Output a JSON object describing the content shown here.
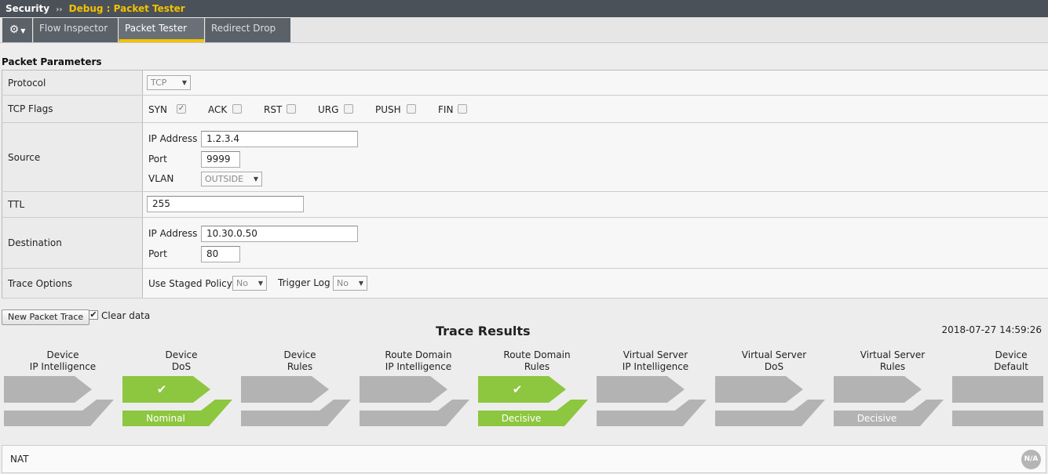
{
  "breadcrumb": {
    "root": "Security",
    "separator": "››",
    "current": "Debug : Packet Tester"
  },
  "tabs": [
    {
      "label": "Flow Inspector"
    },
    {
      "label": "Packet Tester"
    },
    {
      "label": "Redirect Drop"
    }
  ],
  "section_title": "Packet Parameters",
  "params": {
    "protocol": {
      "label": "Protocol",
      "value": "TCP"
    },
    "tcp_flags": {
      "label": "TCP Flags",
      "flags": [
        {
          "name": "SYN",
          "checked": true
        },
        {
          "name": "ACK",
          "checked": false
        },
        {
          "name": "RST",
          "checked": false
        },
        {
          "name": "URG",
          "checked": false
        },
        {
          "name": "PUSH",
          "checked": false
        },
        {
          "name": "FIN",
          "checked": false
        }
      ]
    },
    "source": {
      "label": "Source",
      "ip_label": "IP Address",
      "ip": "1.2.3.4",
      "port_label": "Port",
      "port": "9999",
      "vlan_label": "VLAN",
      "vlan": "OUTSIDE"
    },
    "ttl": {
      "label": "TTL",
      "value": "255"
    },
    "destination": {
      "label": "Destination",
      "ip_label": "IP Address",
      "ip": "10.30.0.50",
      "port_label": "Port",
      "port": "80"
    },
    "trace_options": {
      "label": "Trace Options",
      "staged_label": "Use Staged Policy",
      "staged_value": "No",
      "trigger_label": "Trigger Log",
      "trigger_value": "No"
    }
  },
  "controls": {
    "new_trace": "New Packet Trace",
    "clear_data": "Clear data",
    "clear_checked": true
  },
  "trace": {
    "title": "Trace Results",
    "timestamp": "2018-07-27 14:59:26",
    "stages": [
      {
        "line1": "Device",
        "line2": "IP Intelligence",
        "state": "none",
        "result": ""
      },
      {
        "line1": "Device",
        "line2": "DoS",
        "state": "pass",
        "result": "Nominal"
      },
      {
        "line1": "Device",
        "line2": "Rules",
        "state": "none",
        "result": ""
      },
      {
        "line1": "Route Domain",
        "line2": "IP Intelligence",
        "state": "none",
        "result": ""
      },
      {
        "line1": "Route Domain",
        "line2": "Rules",
        "state": "pass",
        "result": "Decisive"
      },
      {
        "line1": "Virtual Server",
        "line2": "IP Intelligence",
        "state": "none",
        "result": ""
      },
      {
        "line1": "Virtual Server",
        "line2": "DoS",
        "state": "none",
        "result": ""
      },
      {
        "line1": "Virtual Server",
        "line2": "Rules",
        "state": "none",
        "result": "Decisive"
      },
      {
        "line1": "Device",
        "line2": "Default",
        "state": "none",
        "result": ""
      }
    ]
  },
  "nat": {
    "label": "NAT",
    "badge": "N/A"
  },
  "colors": {
    "pass": "#8dc63f",
    "neutral": "#b3b3b3",
    "accent": "#f2c200",
    "header": "#4b5158"
  }
}
